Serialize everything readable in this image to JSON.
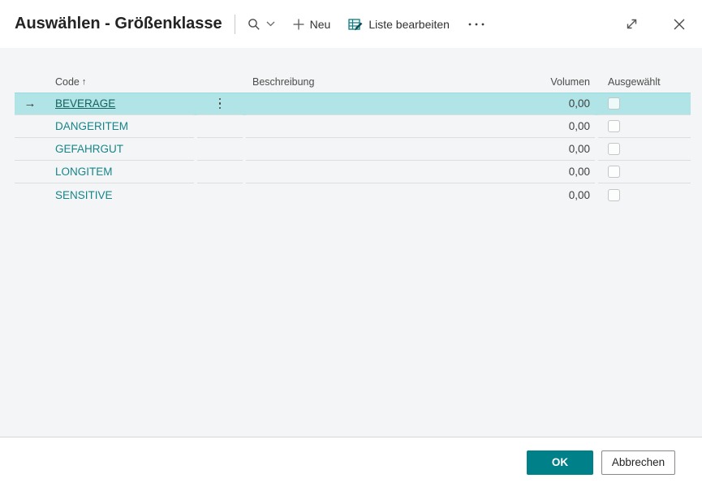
{
  "dialog_title": "Auswählen - Größenklasse",
  "toolbar": {
    "new_label": "Neu",
    "edit_list_label": "Liste bearbeiten"
  },
  "table": {
    "headers": {
      "code": "Code",
      "sort_indicator": "↑",
      "description": "Beschreibung",
      "volume": "Volumen",
      "selected": "Ausgewählt"
    },
    "rows": [
      {
        "code": "BEVERAGE",
        "description": "",
        "volume": "0,00",
        "selected": true,
        "checked": false
      },
      {
        "code": "DANGERITEM",
        "description": "",
        "volume": "0,00",
        "selected": false,
        "checked": false
      },
      {
        "code": "GEFAHRGUT",
        "description": "",
        "volume": "0,00",
        "selected": false,
        "checked": false
      },
      {
        "code": "LONGITEM",
        "description": "",
        "volume": "0,00",
        "selected": false,
        "checked": false
      },
      {
        "code": "SENSITIVE",
        "description": "",
        "volume": "0,00",
        "selected": false,
        "checked": false
      }
    ],
    "row_indicator": "→"
  },
  "footer": {
    "ok_label": "OK",
    "cancel_label": "Abbrechen"
  },
  "colors": {
    "accent": "#008089",
    "selection_bg": "#b1e4e6",
    "link": "#16858a",
    "content_bg": "#f4f5f6"
  }
}
